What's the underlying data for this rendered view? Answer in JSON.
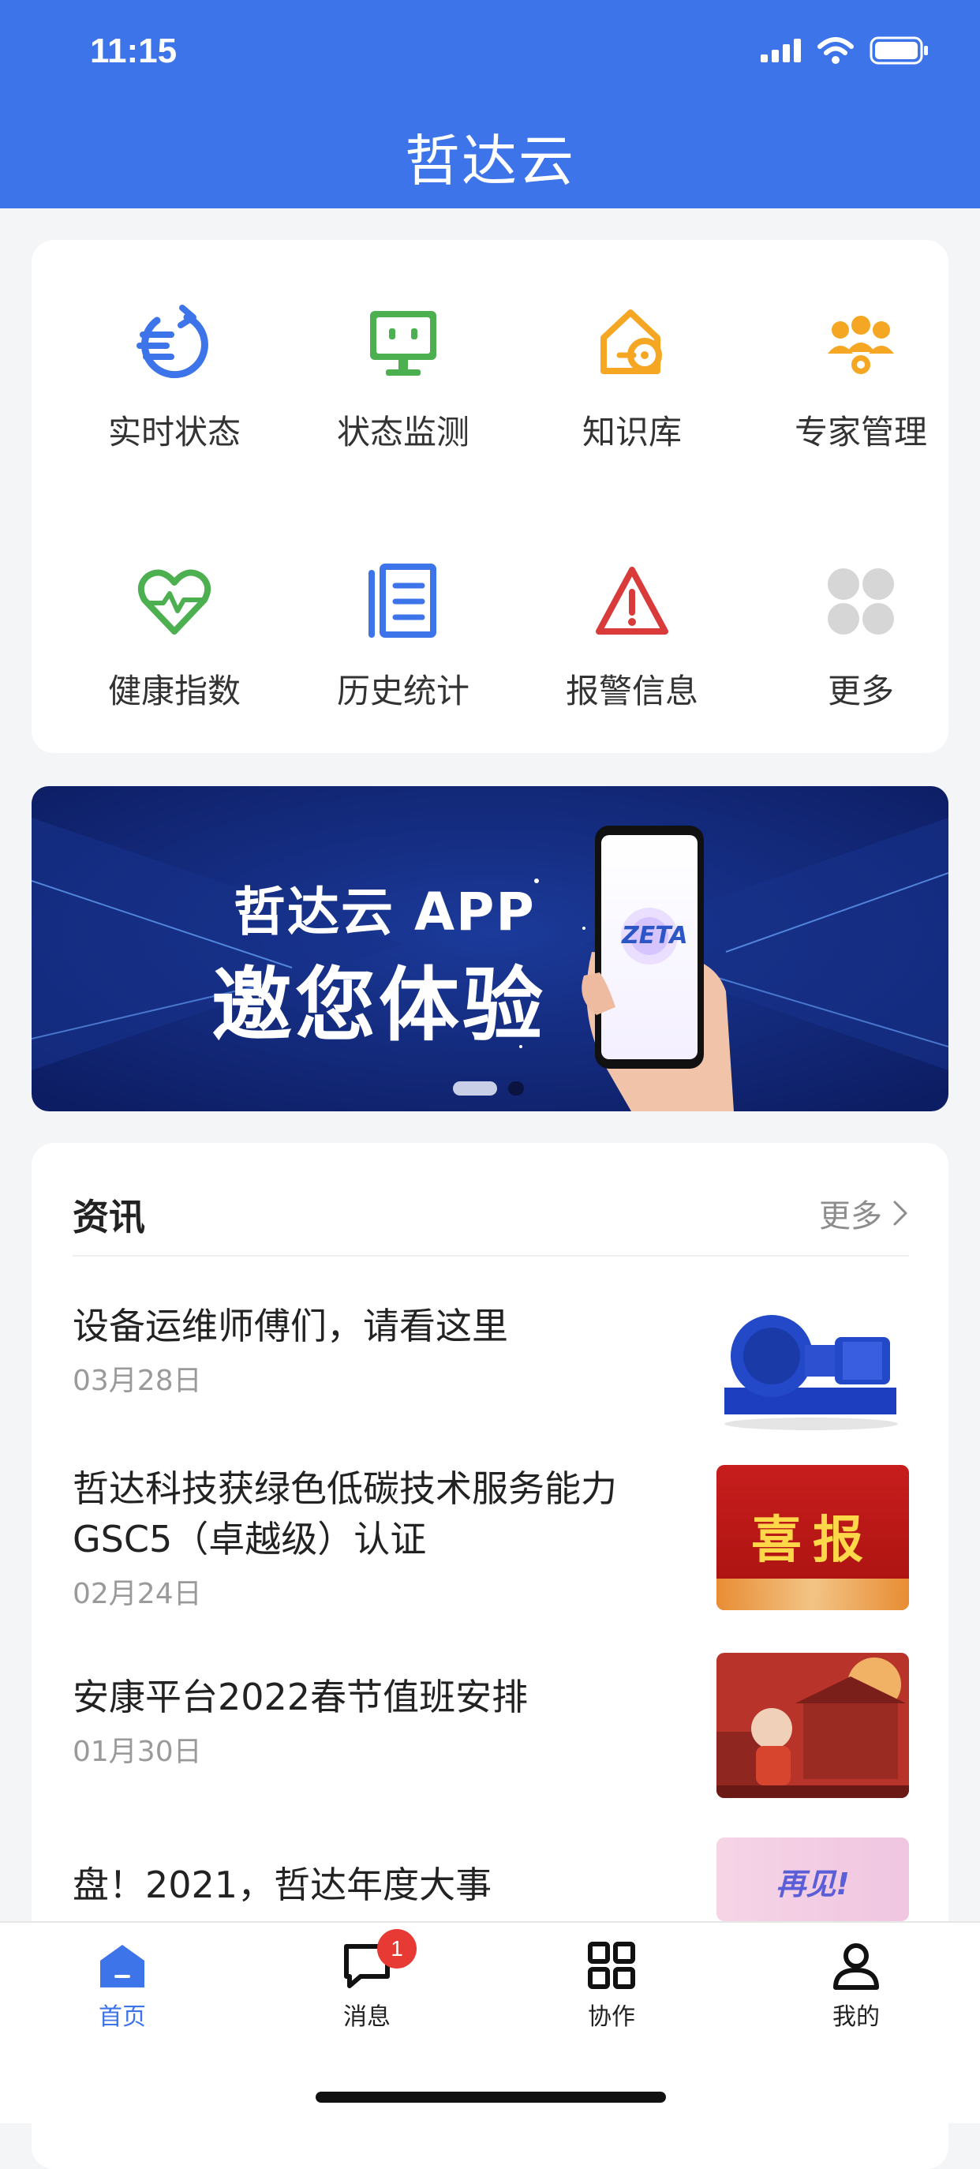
{
  "status": {
    "time": "11:15"
  },
  "header": {
    "title": "哲达云"
  },
  "grid": {
    "items": [
      {
        "label": "实时状态",
        "icon": "realtime-status-icon",
        "color": "#3d74ea"
      },
      {
        "label": "状态监测",
        "icon": "monitor-icon",
        "color": "#4caf50"
      },
      {
        "label": "知识库",
        "icon": "knowledge-base-icon",
        "color": "#f5a623"
      },
      {
        "label": "专家管理",
        "icon": "experts-icon",
        "color": "#f5a623"
      },
      {
        "label": "健康指数",
        "icon": "health-heart-icon",
        "color": "#4caf50"
      },
      {
        "label": "历史统计",
        "icon": "history-list-icon",
        "color": "#3d74ea"
      },
      {
        "label": "报警信息",
        "icon": "alarm-warning-icon",
        "color": "#d93a3a"
      },
      {
        "label": "更多",
        "icon": "more-grid-icon",
        "color": "#d6d6d6"
      }
    ]
  },
  "banner": {
    "line1": "哲达云 APP",
    "line2": "邀您体验",
    "logo_text": "ZETA",
    "slides_total": 2,
    "slide_active": 1
  },
  "news": {
    "title": "资讯",
    "more": "更多",
    "items": [
      {
        "title": "设备运维师傅们，请看这里",
        "date": "03月28日"
      },
      {
        "title": "哲达科技获绿色低碳技术服务能力GSC5（卓越级）认证",
        "date": "02月24日",
        "thumb_text": "喜报"
      },
      {
        "title": "安康平台2022春节值班安排",
        "date": "01月30日"
      },
      {
        "title": "盘！2021，哲达年度大事",
        "date": "",
        "thumb_text": "再见!"
      }
    ]
  },
  "tabbar": {
    "items": [
      {
        "label": "首页",
        "active": true
      },
      {
        "label": "消息",
        "badge": "1"
      },
      {
        "label": "协作"
      },
      {
        "label": "我的"
      }
    ]
  }
}
